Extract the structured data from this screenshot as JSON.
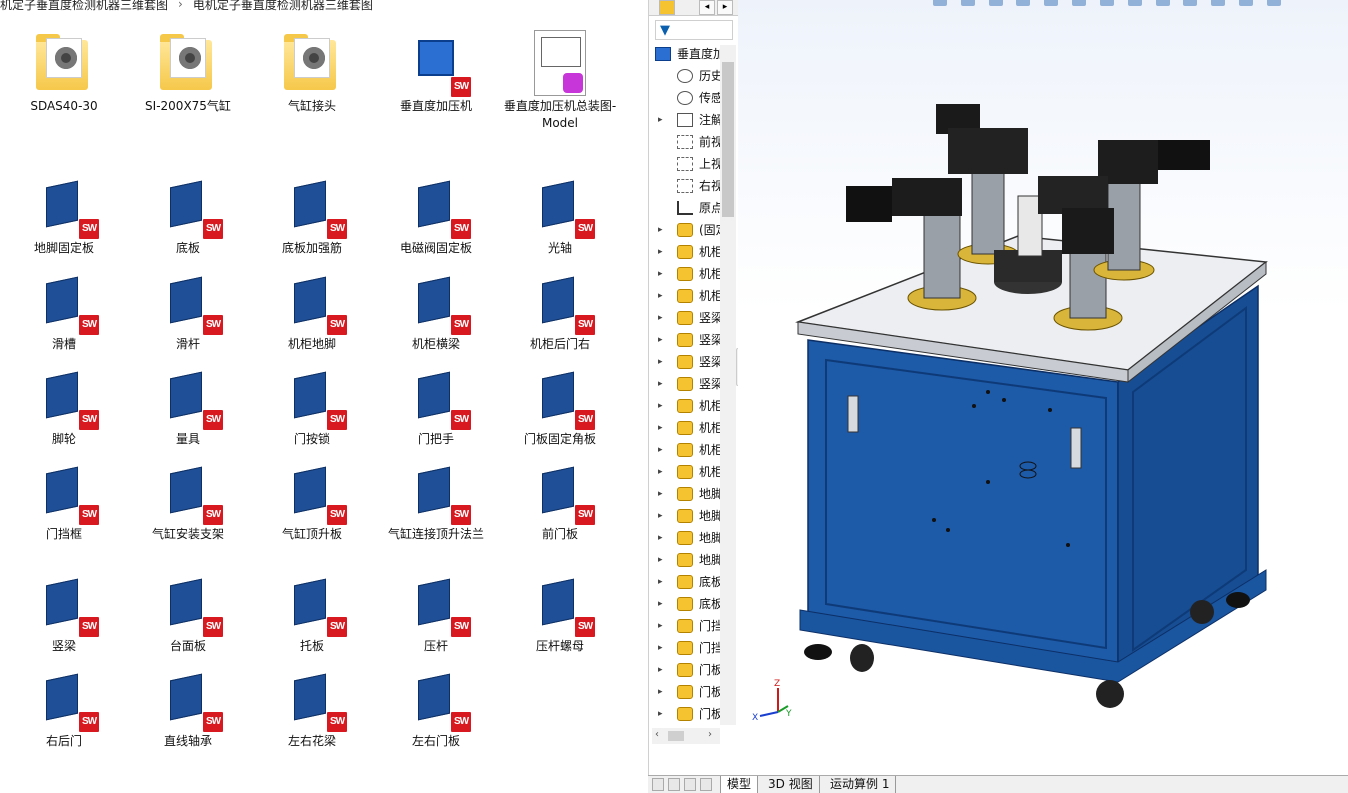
{
  "breadcrumb": [
    "机定子垂直度检测机器三维套图",
    "电机定子垂直度检测机器三维套图"
  ],
  "files": [
    {
      "label": "SDAS40-30",
      "kind": "folder"
    },
    {
      "label": "SI-200X75气缸",
      "kind": "folder"
    },
    {
      "label": "气缸接头",
      "kind": "folder"
    },
    {
      "label": "垂直度加压机",
      "kind": "assembly"
    },
    {
      "label": "垂直度加压机总装图-Model",
      "kind": "drawing"
    },
    {
      "label": "地脚固定板",
      "kind": "part"
    },
    {
      "label": "底板",
      "kind": "part"
    },
    {
      "label": "底板加强筋",
      "kind": "part"
    },
    {
      "label": "电磁阀固定板",
      "kind": "part"
    },
    {
      "label": "光轴",
      "kind": "part"
    },
    {
      "label": "滑槽",
      "kind": "part"
    },
    {
      "label": "滑杆",
      "kind": "part"
    },
    {
      "label": "机柜地脚",
      "kind": "part"
    },
    {
      "label": "机柜横梁",
      "kind": "part"
    },
    {
      "label": "机柜后门右",
      "kind": "part"
    },
    {
      "label": "脚轮",
      "kind": "part"
    },
    {
      "label": "量具",
      "kind": "part"
    },
    {
      "label": "门按锁",
      "kind": "part"
    },
    {
      "label": "门把手",
      "kind": "part"
    },
    {
      "label": "门板固定角板",
      "kind": "part"
    },
    {
      "label": "门挡框",
      "kind": "part"
    },
    {
      "label": "气缸安装支架",
      "kind": "part"
    },
    {
      "label": "气缸顶升板",
      "kind": "part"
    },
    {
      "label": "气缸连接顶升法兰",
      "kind": "part"
    },
    {
      "label": "前门板",
      "kind": "part"
    },
    {
      "label": "竖梁",
      "kind": "part"
    },
    {
      "label": "台面板",
      "kind": "part"
    },
    {
      "label": "托板",
      "kind": "part"
    },
    {
      "label": "压杆",
      "kind": "part"
    },
    {
      "label": "压杆螺母",
      "kind": "part"
    },
    {
      "label": "右后门",
      "kind": "part"
    },
    {
      "label": "直线轴承",
      "kind": "part"
    },
    {
      "label": "左右花梁",
      "kind": "part"
    },
    {
      "label": "左右门板",
      "kind": "part"
    }
  ],
  "sw_badge": "SW",
  "tree": {
    "root_label": "垂直度加",
    "items": [
      {
        "label": "历史",
        "icon": "history-icon",
        "expand": ""
      },
      {
        "label": "传感",
        "icon": "sensor-icon",
        "expand": ""
      },
      {
        "label": "注解",
        "icon": "annotation-icon",
        "expand": "▸"
      },
      {
        "label": "前视",
        "icon": "plane-icon",
        "expand": ""
      },
      {
        "label": "上视",
        "icon": "plane-icon",
        "expand": ""
      },
      {
        "label": "右视",
        "icon": "plane-icon",
        "expand": ""
      },
      {
        "label": "原点",
        "icon": "origin-icon",
        "expand": ""
      },
      {
        "label": "(固定",
        "icon": "part-icon",
        "expand": "▸"
      },
      {
        "label": "机柜",
        "icon": "part-icon",
        "expand": "▸"
      },
      {
        "label": "机柜",
        "icon": "part-icon",
        "expand": "▸"
      },
      {
        "label": "机柜",
        "icon": "part-icon",
        "expand": "▸"
      },
      {
        "label": "竖梁",
        "icon": "part-icon",
        "expand": "▸"
      },
      {
        "label": "竖梁",
        "icon": "part-icon",
        "expand": "▸"
      },
      {
        "label": "竖梁",
        "icon": "part-icon",
        "expand": "▸"
      },
      {
        "label": "竖梁",
        "icon": "part-icon",
        "expand": "▸"
      },
      {
        "label": "机柜",
        "icon": "part-icon",
        "expand": "▸"
      },
      {
        "label": "机柜",
        "icon": "part-icon",
        "expand": "▸"
      },
      {
        "label": "机柜",
        "icon": "part-icon",
        "expand": "▸"
      },
      {
        "label": "机柜",
        "icon": "part-icon",
        "expand": "▸"
      },
      {
        "label": "地脚",
        "icon": "part-icon",
        "expand": "▸"
      },
      {
        "label": "地脚",
        "icon": "part-icon",
        "expand": "▸"
      },
      {
        "label": "地脚",
        "icon": "part-icon",
        "expand": "▸"
      },
      {
        "label": "地脚",
        "icon": "part-icon",
        "expand": "▸"
      },
      {
        "label": "底板",
        "icon": "part-icon",
        "expand": "▸"
      },
      {
        "label": "底板",
        "icon": "part-icon",
        "expand": "▸"
      },
      {
        "label": "门挡",
        "icon": "part-icon",
        "expand": "▸"
      },
      {
        "label": "门挡",
        "icon": "part-icon",
        "expand": "▸"
      },
      {
        "label": "门板",
        "icon": "part-icon",
        "expand": "▸"
      },
      {
        "label": "门板",
        "icon": "part-icon",
        "expand": "▸"
      },
      {
        "label": "门板",
        "icon": "part-icon",
        "expand": "▸"
      }
    ]
  },
  "tabs": [
    "模型",
    "3D 视图",
    "运动算例 1"
  ],
  "axis_labels": {
    "x": "X",
    "y": "Y",
    "z": "Z"
  },
  "colors": {
    "sw_red": "#d8191f",
    "cabinet_blue": "#1d5aa8",
    "part_blue": "#1f4f96"
  }
}
